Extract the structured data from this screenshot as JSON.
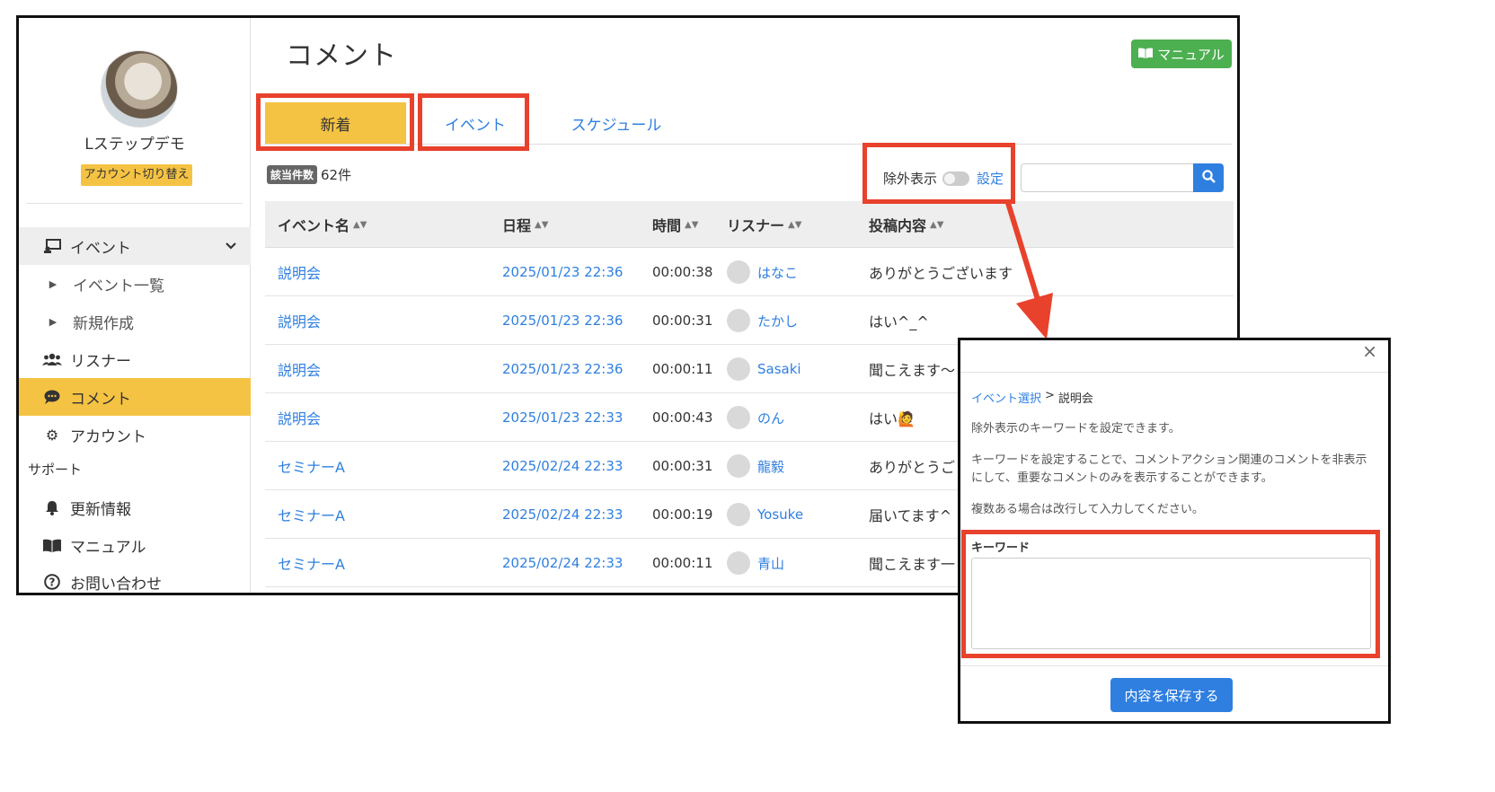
{
  "page": {
    "title": "コメント",
    "manual_label": "マニュアル"
  },
  "sidebar": {
    "profile_name": "Lステップデモ",
    "account_switch_label": "アカウント切り替え",
    "event_group_label": "イベント",
    "event_list_label": "イベント一覧",
    "new_create_label": "新規作成",
    "listener_label": "リスナー",
    "comment_label": "コメント",
    "account_label": "アカウント",
    "support_heading": "サポート",
    "updates_label": "更新情報",
    "manual_label": "マニュアル",
    "contact_label": "お問い合わせ"
  },
  "tabs": {
    "new": "新着",
    "event": "イベント",
    "schedule": "スケジュール"
  },
  "count": {
    "badge": "該当件数",
    "text": "62件"
  },
  "filter": {
    "exclude_label": "除外表示",
    "settings_link": "設定",
    "exclude_enabled": false
  },
  "table": {
    "headers": {
      "event": "イベント名",
      "date": "日程",
      "time": "時間",
      "listener": "リスナー",
      "body": "投稿内容"
    },
    "rows": [
      {
        "event": "説明会",
        "date": "2025/01/23 22:36",
        "time": "00:00:38",
        "listener": "はなこ",
        "body": "ありがとうございます"
      },
      {
        "event": "説明会",
        "date": "2025/01/23 22:36",
        "time": "00:00:31",
        "listener": "たかし",
        "body": "はい^_^"
      },
      {
        "event": "説明会",
        "date": "2025/01/23 22:36",
        "time": "00:00:11",
        "listener": "Sasaki",
        "body": "聞こえます〜"
      },
      {
        "event": "説明会",
        "date": "2025/01/23 22:33",
        "time": "00:00:43",
        "listener": "のん",
        "body": "はい🙋"
      },
      {
        "event": "セミナーA",
        "date": "2025/02/24 22:33",
        "time": "00:00:31",
        "listener": "龍毅",
        "body": "ありがとうご"
      },
      {
        "event": "セミナーA",
        "date": "2025/02/24 22:33",
        "time": "00:00:19",
        "listener": "Yosuke",
        "body": "届いてます^ ^"
      },
      {
        "event": "セミナーA",
        "date": "2025/02/24 22:33",
        "time": "00:00:11",
        "listener": "青山",
        "body": "聞こえます一"
      }
    ]
  },
  "modal": {
    "close": "×",
    "breadcrumb_link": "イベント選択",
    "breadcrumb_sep": ">",
    "breadcrumb_current": "説明会",
    "desc1": "除外表示のキーワードを設定できます。",
    "desc2": "キーワードを設定することで、コメントアクション関連のコメントを非表示にして、重要なコメントのみを表示することができます。",
    "desc3": "複数ある場合は改行して入力してください。",
    "keyword_label": "キーワード",
    "keyword_value": "",
    "save_label": "内容を保存する"
  },
  "colors": {
    "accent_yellow": "#f5c343",
    "link_blue": "#2f7fe0",
    "highlight_red": "#e8412c",
    "manual_green": "#4caf50"
  }
}
